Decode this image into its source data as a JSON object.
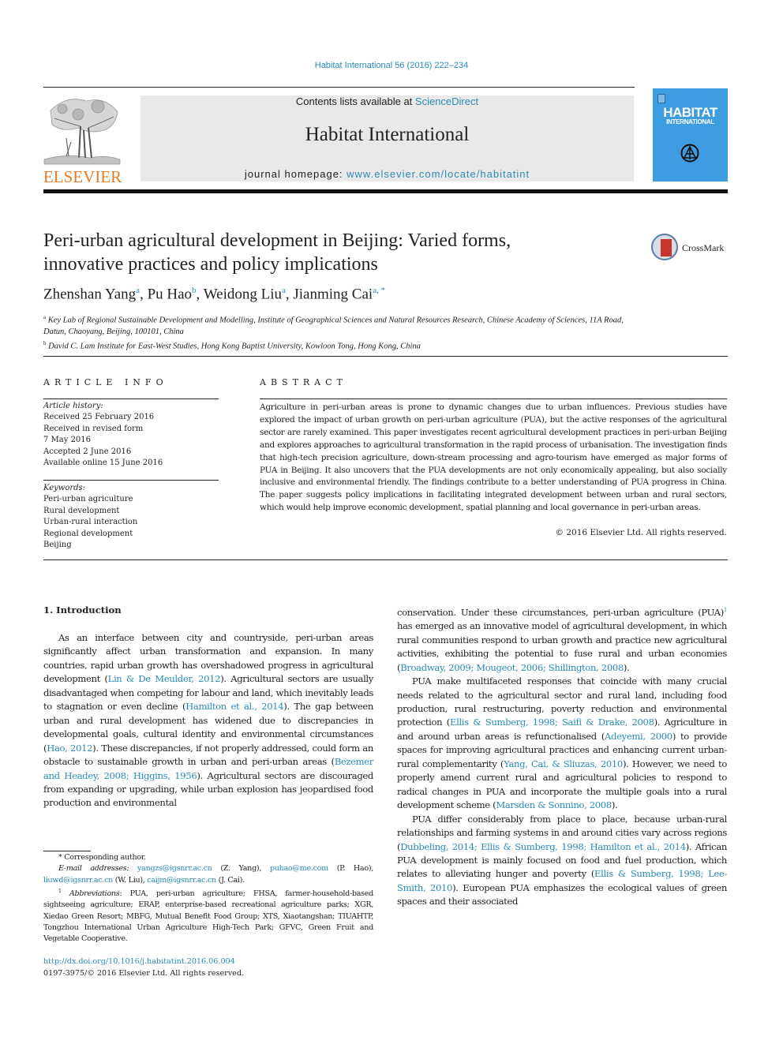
{
  "running_head": "Habitat International 56 (2016) 222–234",
  "masthead": {
    "publisher_logo_text": "ELSEVIER",
    "contents_prefix": "Contents lists available at ",
    "contents_link": "ScienceDirect",
    "journal_title": "Habitat International",
    "homepage_prefix": "journal homepage: ",
    "homepage_link": "www.elsevier.com/locate/habitatint",
    "cover_title": "HABITAT",
    "cover_subtitle": "INTERNATIONAL"
  },
  "article": {
    "title_line1": "Peri-urban agricultural development in Beijing: Varied forms,",
    "title_line2": "innovative practices and policy implications",
    "crossmark_label": "CrossMark",
    "authors": [
      {
        "name": "Zhenshan Yang",
        "sup": "a"
      },
      {
        "name": "Pu Hao",
        "sup": "b"
      },
      {
        "name": "Weidong Liu",
        "sup": "a"
      },
      {
        "name": "Jianming Cai",
        "sup": "a, *"
      }
    ],
    "affiliations": [
      {
        "sup": "a",
        "text": "Key Lab of Regional Sustainable Development and Modelling, Institute of Geographical Sciences and Natural Resources Research, Chinese Academy of Sciences, 11A Road, Datun, Chaoyang, Beijing, 100101, China"
      },
      {
        "sup": "b",
        "text": "David C. Lam Institute for East-West Studies, Hong Kong Baptist University, Kowloon Tong, Hong Kong, China"
      }
    ]
  },
  "article_info": {
    "heading": "ARTICLE INFO",
    "history_label": "Article history:",
    "history": [
      "Received 25 February 2016",
      "Received in revised form",
      "7 May 2016",
      "Accepted 2 June 2016",
      "Available online 15 June 2016"
    ],
    "keywords_label": "Keywords:",
    "keywords": [
      "Peri-urban agriculture",
      "Rural development",
      "Urban-rural interaction",
      "Regional development",
      "Beijing"
    ]
  },
  "abstract": {
    "heading": "ABSTRACT",
    "text": "Agriculture in peri-urban areas is prone to dynamic changes due to urban influences. Previous studies have explored the impact of urban growth on peri-urban agriculture (PUA), but the active responses of the agricultural sector are rarely examined. This paper investigates recent agricultural development practices in peri-urban Beijing and explores approaches to agricultural transformation in the rapid process of urbanisation. The investigation finds that high-tech precision agriculture, down-stream processing and agro-tourism have emerged as major forms of PUA in Beijing. It also uncovers that the PUA developments are not only economically appealing, but also socially inclusive and environmental friendly. The findings contribute to a better understanding of PUA progress in China. The paper suggests policy implications in facilitating integrated development between urban and rural sectors, which would help improve economic development, spatial planning and local governance in peri-urban areas.",
    "copyright": "© 2016 Elsevier Ltd. All rights reserved."
  },
  "body": {
    "section_heading": "1.  Introduction",
    "left_p1": {
      "t1": "As an interface between city and countryside, peri-urban areas significantly affect urban transformation and expansion. In many countries, rapid urban growth has overshadowed progress in agricultural development (",
      "c1": "Lin & De Meulder, 2012",
      "t2": "). Agricultural sectors are usually disadvantaged when competing for labour and land, which inevitably leads to stagnation or even decline (",
      "c2": "Hamilton et al., 2014",
      "t3": "). The gap between urban and rural development has widened due to discrepancies in developmental goals, cultural identity and environmental circumstances (",
      "c3": "Hao, 2012",
      "t4": "). These discrepancies, if not properly addressed, could form an obstacle to sustainable growth in urban and peri-urban areas (",
      "c4": "Bezemer and Headey, 2008; Higgins, 1956",
      "t5": "). Agricultural sectors are discouraged from expanding or upgrading, while urban explosion has jeopardised food production and environmental"
    },
    "right_p1": {
      "t1": "conservation. Under these circumstances, peri-urban agriculture (PUA)",
      "sup": "1",
      "t2": " has emerged as an innovative model of agricultural development, in which rural communities respond to urban growth and practice new agricultural activities, exhibiting the potential to fuse rural and urban economies (",
      "c1": "Broadway, 2009; Mougeot, 2006; Shillington, 2008",
      "t3": ")."
    },
    "right_p2": {
      "t1": "PUA make multifaceted responses that coincide with many crucial needs related to the agricultural sector and rural land, including food production, rural restructuring, poverty reduction and environmental protection (",
      "c1": "Ellis & Sumberg, 1998; Saifi & Drake, 2008",
      "t2": "). Agriculture in and around urban areas is refunctionalised (",
      "c2": "Adeyemi, 2000",
      "t3": ") to provide spaces for improving agricultural practices and enhancing current urban-rural complementarity (",
      "c3": "Yang, Cai, & Sliuzas, 2010",
      "t4": "). However, we need to properly amend current rural and agricultural policies to respond to radical changes in PUA and incorporate the multiple goals into a rural development scheme (",
      "c4": "Marsden & Sonnino, 2008",
      "t5": ")."
    },
    "right_p3": {
      "t1": "PUA differ considerably from place to place, because urban-rural relationships and farming systems in and around cities vary across regions (",
      "c1": "Dubbeling, 2014; Ellis & Sumberg, 1998; Hamilton et al., 2014",
      "t2": "). African PUA development is mainly focused on food and fuel production, which relates to alleviating hunger and poverty (",
      "c2": "Ellis & Sumberg, 1998; Lee-Smith, 2010",
      "t3": "). European PUA emphasizes the ecological values of green spaces and their associated"
    }
  },
  "footnotes": {
    "corresponding": "* Corresponding author.",
    "email_label": "E-mail addresses:",
    "emails": [
      {
        "address": "yangzs@igsnrr.ac.cn",
        "owner": "(Z. Yang),"
      },
      {
        "address": "puhao@me.com",
        "owner": "(P. Hao),"
      },
      {
        "address": "liuwd@igsnrr.ac.cn",
        "owner": "(W. Liu),"
      },
      {
        "address": "caijm@igsnrr.ac.cn",
        "owner": "(J. Cai)."
      }
    ],
    "abbrev_sup": "1",
    "abbrev_label": "Abbreviations",
    "abbrev_text": ": PUA, peri-urban agriculture; FHSA, farmer-household-based sightseeing agriculture; ERAP, enterprise-based recreational agriculture parks; XGR, Xiedao Green Resort; MBFG, Mutual Benefit Food Group; XTS, Xiaotangshan; TIUAHTP, Tongzhou International Urban Agriculture High-Tech Park; GFVC, Green Fruit and Vegetable Cooperative."
  },
  "doi": {
    "link": "http://dx.doi.org/10.1016/j.habitatint.2016.06.004",
    "issn_line": "0197-3975/© 2016 Elsevier Ltd. All rights reserved."
  },
  "colors": {
    "link": "#2a8ab8",
    "elsevier_orange": "#e87b25",
    "cover_blue": "#3d9de0",
    "masthead_gray": "#e9e9e9"
  }
}
